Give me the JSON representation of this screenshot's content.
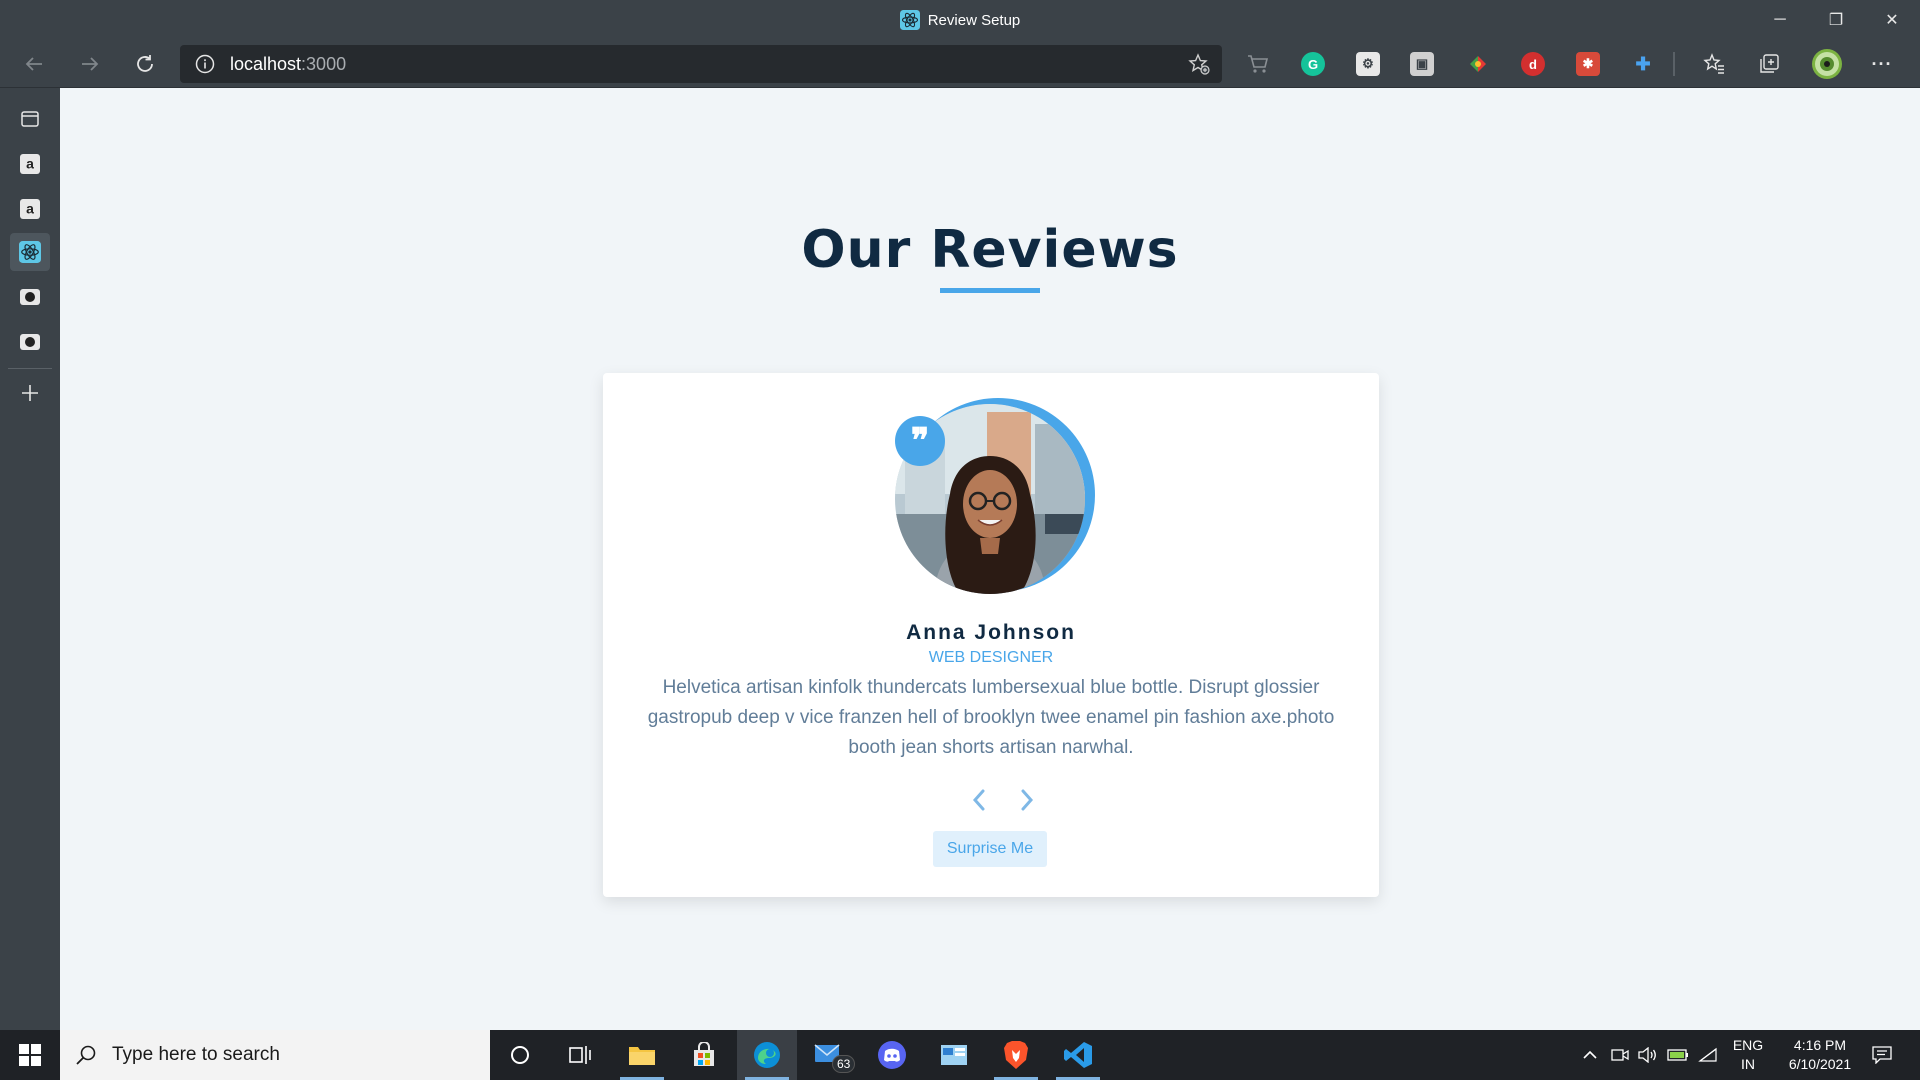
{
  "window": {
    "title": "Review Setup",
    "minimize_label": "─",
    "restore_label": "❐",
    "close_label": "✕"
  },
  "toolbar": {
    "url_host": "localhost",
    "url_port": ":3000"
  },
  "sidebar": {
    "items": [
      "tab-actions",
      "amazon-tab",
      "amazon-tab",
      "react-tab",
      "github-tab",
      "github-tab"
    ]
  },
  "review": {
    "heading": "Our Reviews",
    "name": "Anna Johnson",
    "job": "web designer",
    "text": "Helvetica artisan kinfolk thundercats lumbersexual blue bottle. Disrupt glossier gastropub deep v vice franzen hell of brooklyn twee enamel pin fashion axe.photo booth jean shorts artisan narwhal.",
    "quote_glyph": "❞",
    "surprise_label": "Surprise Me"
  },
  "taskbar": {
    "search_placeholder": "Type here to search",
    "mail_badge": "63",
    "lang_line1": "ENG",
    "lang_line2": "IN",
    "time": "4:16 PM",
    "date": "6/10/2021"
  },
  "colors": {
    "accent": "#49a6e9",
    "heading": "#102a42",
    "body_text": "#617d98",
    "page_bg": "#f1f5f8",
    "chrome_bg": "#3b4248"
  }
}
